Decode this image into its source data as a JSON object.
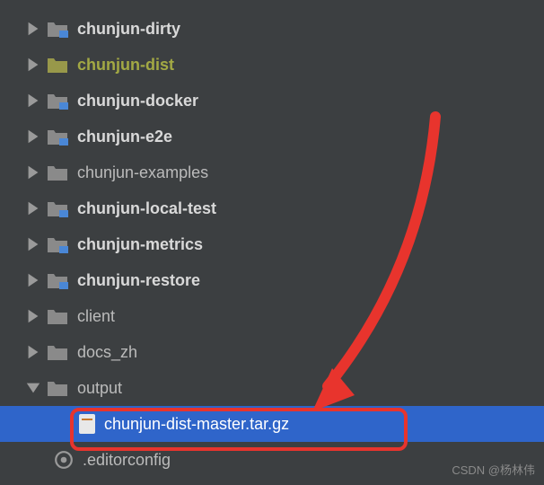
{
  "tree": {
    "items": [
      {
        "label": "chunjun-dirty",
        "bold": true,
        "type": "module",
        "expand": "right"
      },
      {
        "label": "chunjun-dist",
        "bold": true,
        "type": "dist",
        "expand": "right"
      },
      {
        "label": "chunjun-docker",
        "bold": true,
        "type": "module",
        "expand": "right"
      },
      {
        "label": "chunjun-e2e",
        "bold": true,
        "type": "module",
        "expand": "right"
      },
      {
        "label": "chunjun-examples",
        "bold": false,
        "type": "folder",
        "expand": "right"
      },
      {
        "label": "chunjun-local-test",
        "bold": true,
        "type": "module",
        "expand": "right"
      },
      {
        "label": "chunjun-metrics",
        "bold": true,
        "type": "module",
        "expand": "right"
      },
      {
        "label": "chunjun-restore",
        "bold": true,
        "type": "module",
        "expand": "right"
      },
      {
        "label": "client",
        "bold": false,
        "type": "folder",
        "expand": "right"
      },
      {
        "label": "docs_zh",
        "bold": false,
        "type": "folder",
        "expand": "right"
      },
      {
        "label": "output",
        "bold": false,
        "type": "folder",
        "expand": "down"
      }
    ],
    "selectedFile": "chunjun-dist-master.tar.gz",
    "configFile": ".editorconfig"
  },
  "watermark": "CSDN @杨林伟"
}
